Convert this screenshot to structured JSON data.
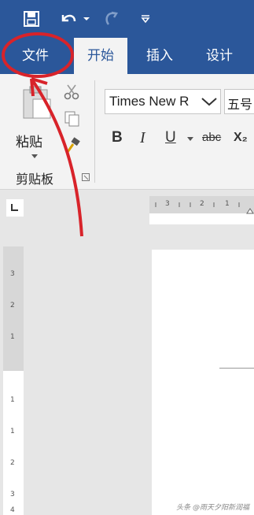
{
  "quick_access": {
    "save_icon": "save-icon",
    "undo_icon": "undo-icon",
    "redo_icon": "redo-icon",
    "customize_icon": "customize-qat-icon"
  },
  "tabs": [
    {
      "label": "文件",
      "active": false
    },
    {
      "label": "开始",
      "active": true
    },
    {
      "label": "插入",
      "active": false
    },
    {
      "label": "设计",
      "active": false
    }
  ],
  "clipboard": {
    "paste_label": "粘贴",
    "group_label": "剪贴板"
  },
  "font": {
    "name": "Times New R",
    "size": "五号"
  },
  "format_buttons": [
    "B",
    "I",
    "U",
    "abc",
    "X₂"
  ],
  "horizontal_ruler": [
    "3",
    "2",
    "1"
  ],
  "vertical_ruler": [
    "3",
    "2",
    "1",
    "1",
    "1",
    "2",
    "3",
    "4"
  ],
  "watermark": "头条 @雨天夕阳新润福",
  "colors": {
    "brand": "#2b579a",
    "annotation": "#d8232a"
  }
}
